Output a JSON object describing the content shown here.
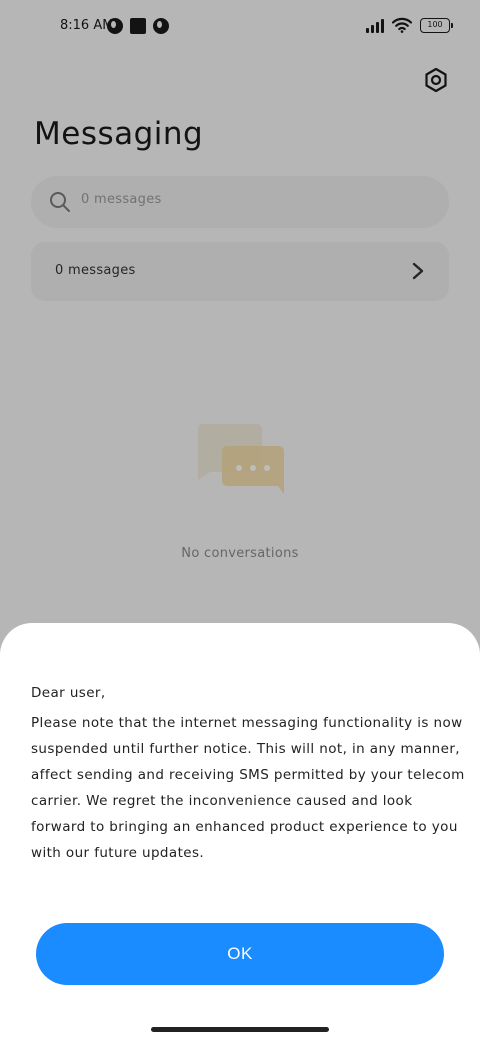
{
  "status_bar": {
    "time": "8:16 AM",
    "battery": "100",
    "icons": [
      "notification-icon",
      "square-notification-icon",
      "notification-icon",
      "signal-icon",
      "wifi-icon",
      "battery-icon"
    ]
  },
  "header": {
    "title": "Messaging",
    "settings_icon": "gear-icon"
  },
  "search": {
    "placeholder": "0 messages",
    "icon": "search-icon"
  },
  "messages_card": {
    "label": "0 messages",
    "icon": "chevron-right-icon"
  },
  "empty_state": {
    "text": "No conversations",
    "icon": "chat-bubbles-icon",
    "colors": {
      "back_bubble": "#f1ead9",
      "front_bubble": "#f2dba8"
    }
  },
  "dialog": {
    "greeting": "Dear user,",
    "body": "Please note that the internet messaging functionality is now suspended until further notice. This will not, in any manner, affect sending and receiving SMS permitted by your telecom carrier. We regret the inconvenience caused and look forward to bringing an enhanced product experience to you with our future updates.",
    "ok_label": "OK",
    "colors": {
      "button": "#1a8cff",
      "button_text": "#ffffff"
    }
  }
}
